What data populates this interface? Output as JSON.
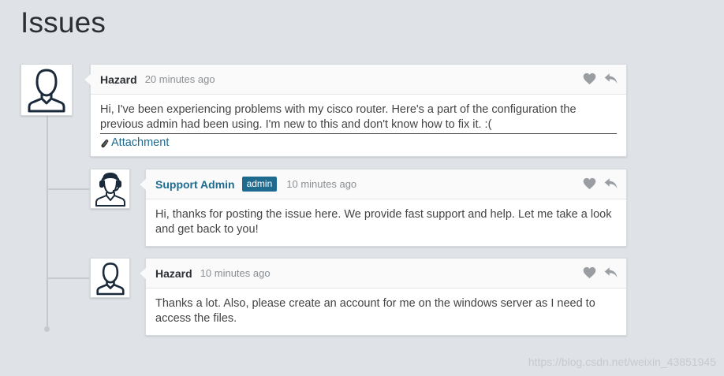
{
  "page": {
    "title": "Issues"
  },
  "comments": [
    {
      "author": "Hazard",
      "badge": "",
      "time": "20 minutes ago",
      "text": "Hi, I've been experiencing problems with my cisco router. Here's a part of the configuration the previous admin had been using. I'm new to this and don't know how to fix it. :(",
      "attachment_label": "Attachment",
      "avatar_icon": "user-icon"
    },
    {
      "author": "Support Admin",
      "badge": "admin",
      "time": "10 minutes ago",
      "text": "Hi, thanks for posting the issue here. We provide fast support and help. Let me take a look and get back to you!",
      "avatar_icon": "support-agent-icon"
    },
    {
      "author": "Hazard",
      "badge": "",
      "time": "10 minutes ago",
      "text": "Thanks a lot. Also, please create an account for me on the windows server as I need to access the files.",
      "avatar_icon": "user-icon"
    }
  ],
  "icons": {
    "like": "heart-icon",
    "reply": "reply-icon",
    "attachment": "paperclip-icon"
  },
  "colors": {
    "accent": "#1e6b8f",
    "background": "#dfe2e6",
    "icon_gray": "#9a9ea2"
  },
  "watermark": "https://blog.csdn.net/weixin_43851945"
}
